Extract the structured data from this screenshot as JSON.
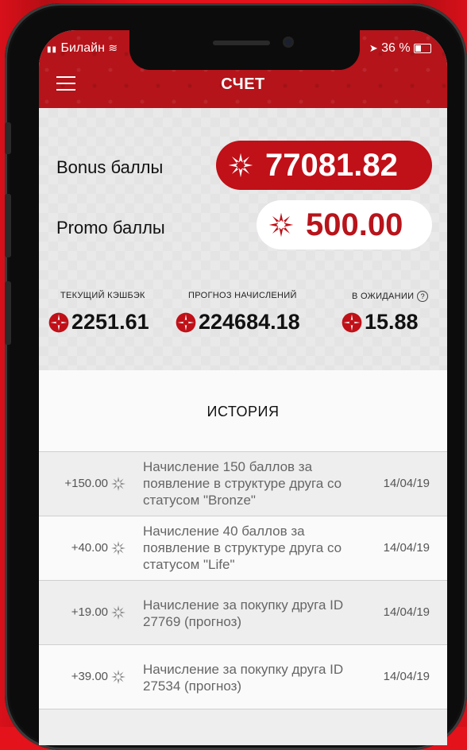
{
  "status_bar": {
    "carrier": "Билайн",
    "battery": "36 %"
  },
  "header": {
    "title": "СЧЕТ",
    "menu_icon": "hamburger-icon"
  },
  "balances": {
    "bonus_label": "Bonus баллы",
    "bonus_value": "77081.82",
    "promo_label": "Promo баллы",
    "promo_value": "500.00"
  },
  "stats": [
    {
      "label": "ТЕКУЩИЙ КЭШБЭК",
      "value": "2251.61"
    },
    {
      "label": "ПРОГНОЗ НАЧИСЛЕНИЙ",
      "value": "224684.18"
    },
    {
      "label": "В ОЖИДАНИИ",
      "value": "15.88",
      "info_icon": "?"
    }
  ],
  "history": {
    "title": "ИСТОРИЯ",
    "rows": [
      {
        "amount": "+150.00",
        "desc": "Начисление 150 баллов за появление в структуре друга со статусом \"Bronze\"",
        "date": "14/04/19"
      },
      {
        "amount": "+40.00",
        "desc": "Начисление 40 баллов за появление в структуре друга со статусом \"Life\"",
        "date": "14/04/19"
      },
      {
        "amount": "+19.00",
        "desc": "Начисление за покупку друга ID 27769 (прогноз)",
        "date": "14/04/19"
      },
      {
        "amount": "+39.00",
        "desc": "Начисление за покупку друга ID 27534 (прогноз)",
        "date": "14/04/19"
      }
    ]
  },
  "colors": {
    "brand_red": "#c01018",
    "header_red": "#b4141a",
    "background_red": "#e3121b"
  }
}
